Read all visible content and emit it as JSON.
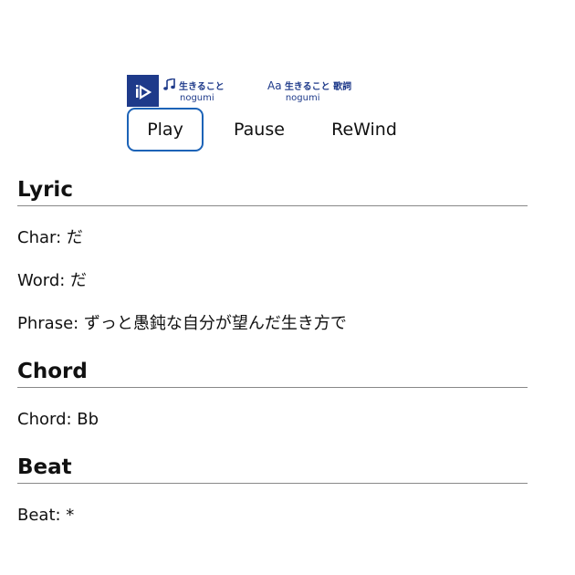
{
  "player": {
    "song": {
      "title": "生きること",
      "artist": "nogumi"
    },
    "lyrics_source": {
      "title": "生きること 歌詞",
      "artist": "nogumi"
    },
    "logo_icon": "textalive-logo-icon",
    "accent_color": "#1e3a8a"
  },
  "controls": {
    "play_label": "Play",
    "pause_label": "Pause",
    "rewind_label": "ReWind",
    "active": "play",
    "active_border_color": "#1c63b7"
  },
  "lyric": {
    "heading": "Lyric",
    "char_label": "Char: だ",
    "word_label": "Word: だ",
    "phrase_label": "Phrase: ずっと愚鈍な自分が望んだ生き方で"
  },
  "chord": {
    "heading": "Chord",
    "chord_label": "Chord: Bb"
  },
  "beat": {
    "heading": "Beat",
    "beat_label": "Beat: *"
  }
}
